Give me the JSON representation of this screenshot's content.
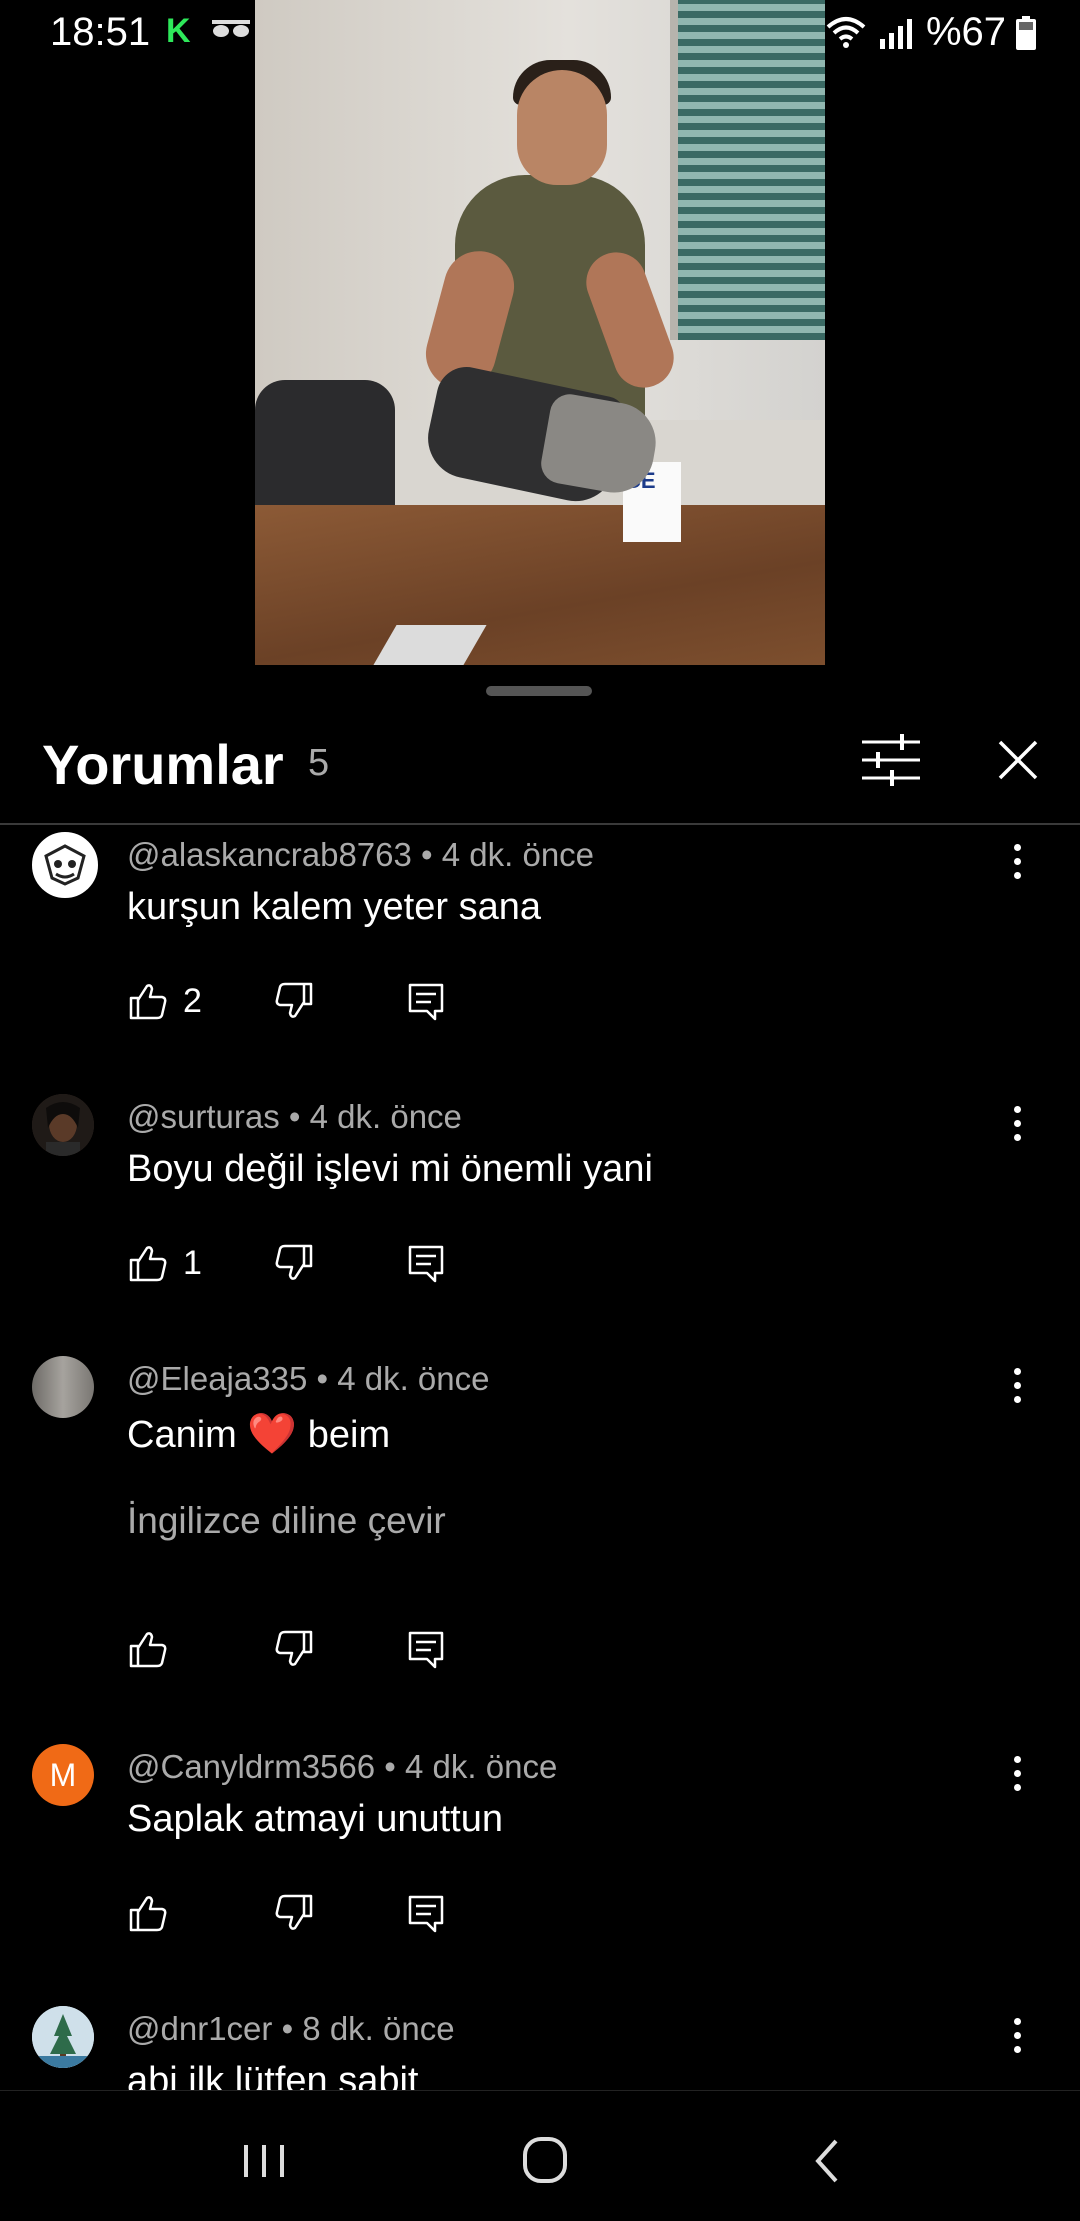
{
  "status_bar": {
    "time": "18:51",
    "app_icon": "K",
    "battery": "%67"
  },
  "sheet": {
    "title": "Yorumlar",
    "count": "5"
  },
  "comments": [
    {
      "user": "@alaskancrab8763",
      "time": "4 dk. önce",
      "text": "kurşun kalem yeter sana",
      "likes": "2",
      "avatar_color": "#ffffff"
    },
    {
      "user": "@surturas",
      "time": "4 dk. önce",
      "text": "Boyu değil işlevi mi önemli yani",
      "likes": "1",
      "avatar_color": "#3a2a22"
    },
    {
      "user": "@Eleaja335",
      "time": "4 dk. önce",
      "text_before": "Canim",
      "emoji": "❤️",
      "text_after": "beim",
      "translate": "İngilizce diline çevir",
      "likes": "",
      "avatar_color": "#8d8a86"
    },
    {
      "user": "@Canyldrm3566",
      "time": "4 dk. önce",
      "text": "Saplak atmayi unuttun",
      "likes": "",
      "avatar_letter": "M",
      "avatar_color": "#f06a16"
    },
    {
      "user": "@dnr1cer",
      "time": "8 dk. önce",
      "text": "abi ilk lütfen sabit",
      "likes": "",
      "avatar_color": "#5a8fb0"
    }
  ],
  "separator": "•",
  "icons": {
    "like": "thumb-up-icon",
    "dislike": "thumb-down-icon",
    "reply": "reply-icon",
    "more": "more-vertical-icon",
    "filter": "filter-icon",
    "close": "close-icon"
  }
}
